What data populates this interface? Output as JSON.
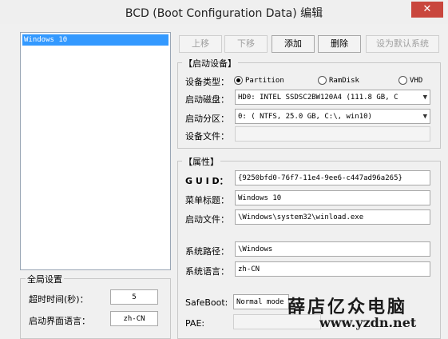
{
  "window": {
    "title": "BCD (Boot Configuration Data) 编辑",
    "close": "✕"
  },
  "entries": [
    {
      "label": "Windows 10"
    }
  ],
  "toolbar": {
    "up": "上移",
    "down": "下移",
    "add": "添加",
    "delete": "删除",
    "set_default": "设为默认系统"
  },
  "boot_device": {
    "group_title": "【启动设备】",
    "device_type_label": "设备类型：",
    "options": {
      "partition": "Partition",
      "ramdisk": "RamDisk",
      "vhd": "VHD"
    },
    "selected": "Partition",
    "boot_disk_label": "启动磁盘：",
    "boot_disk_value": "HD0: INTEL SSDSC2BW120A4 (111.8 GB, C",
    "boot_partition_label": "启动分区：",
    "boot_partition_value": "0: ( NTFS,  25.0 GB, C:\\, win10)",
    "device_file_label": "设备文件：",
    "device_file_value": ""
  },
  "properties": {
    "group_title": "【属性】",
    "guid_label": "G U I D：",
    "guid_value": "{9250bfd0-76f7-11e4-9ee6-c447ad96a265}",
    "menu_title_label": "菜单标题：",
    "menu_title_value": "Windows 10",
    "boot_file_label": "启动文件：",
    "boot_file_value": "\\Windows\\system32\\winload.exe",
    "system_path_label": "系统路径：",
    "system_path_value": "\\Windows",
    "system_lang_label": "系统语言：",
    "system_lang_value": "zh-CN",
    "safeboot_label": "SafeBoot:",
    "safeboot_value": "Normal mode",
    "pae_label": "PAE:"
  },
  "global": {
    "group_title": "全局设置",
    "timeout_label": "超时时间(秒)：",
    "timeout_value": "5",
    "ui_lang_label": "启动界面语言：",
    "ui_lang_value": "zh-CN"
  },
  "watermark": {
    "text": "薛店亿众电脑",
    "url": "www.yzdn.net"
  }
}
